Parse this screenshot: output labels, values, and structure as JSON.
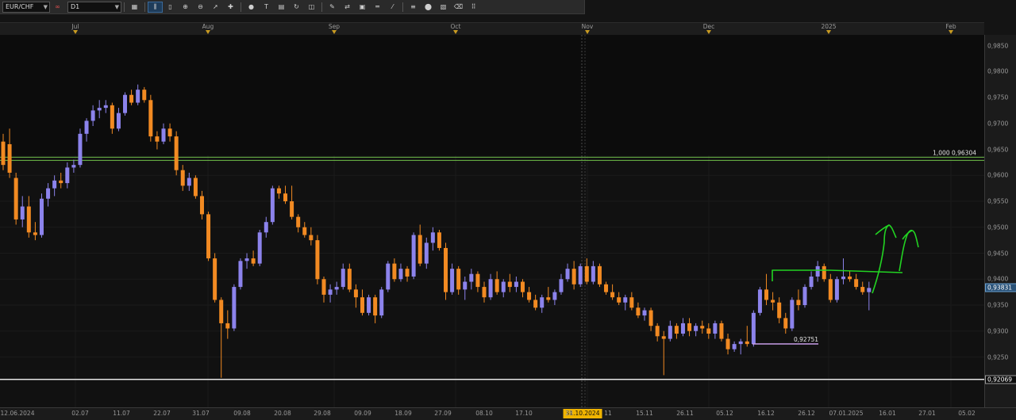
{
  "toolbar": {
    "symbol": "EUR/CHF",
    "timeframe": "D1",
    "link_glyph": "∞",
    "buttons": [
      {
        "name": "chart-type-icon",
        "glyph": "▦"
      },
      {
        "name": "bar-chart-icon",
        "glyph": "⫼",
        "active": true
      },
      {
        "name": "candle-chart-icon",
        "glyph": "▯"
      },
      {
        "name": "zoom-in-icon",
        "glyph": "⊕"
      },
      {
        "name": "zoom-out-icon",
        "glyph": "⊖"
      },
      {
        "name": "cursor-icon",
        "glyph": "➚"
      },
      {
        "name": "crosshair-icon",
        "glyph": "✚"
      },
      {
        "name": "marker-icon",
        "glyph": "●"
      },
      {
        "name": "text-icon",
        "glyph": "T"
      },
      {
        "name": "save-icon",
        "glyph": "▤"
      },
      {
        "name": "refresh-icon",
        "glyph": "↻"
      },
      {
        "name": "layers-icon",
        "glyph": "◫"
      },
      {
        "name": "pencil-icon",
        "glyph": "✎"
      },
      {
        "name": "indicator-icon",
        "glyph": "⇄"
      },
      {
        "name": "template-icon",
        "glyph": "▣"
      },
      {
        "name": "line-icon",
        "glyph": "═"
      },
      {
        "name": "trend-icon",
        "glyph": "⁄"
      },
      {
        "name": "fib-icon",
        "glyph": "≡"
      },
      {
        "name": "shape-icon",
        "glyph": "⬤"
      },
      {
        "name": "alert-icon",
        "glyph": "▧"
      },
      {
        "name": "eraser-icon",
        "glyph": "⌫"
      },
      {
        "name": "more-icon",
        "glyph": "⠿"
      }
    ]
  },
  "colors": {
    "bull": "#8c83ec",
    "bear": "#f28a22",
    "resistance": "#6fbf4a",
    "support": "#e6e6e6",
    "handdrawn": "#22d322",
    "fib_line": "#c79ee8"
  },
  "chart_data": {
    "type": "candlestick",
    "symbol": "EUR/CHF",
    "timeframe": "D1",
    "ylim": [
      0.918,
      0.988
    ],
    "y_ticks": [
      "0,9850",
      "0,9800",
      "0,9750",
      "0,9700",
      "0,9650",
      "0,9600",
      "0,9550",
      "0,9500",
      "0,9450",
      "0,9400",
      "0,9350",
      "0,9300",
      "0,9250"
    ],
    "x_ticks": [
      "12.06.2024",
      "02.07",
      "11.07",
      "22.07",
      "31.07",
      "09.08",
      "20.08",
      "29.08",
      "09.09",
      "18.09",
      "27.09",
      "08.10",
      "17.10",
      "28",
      "31.10.2024",
      "11",
      "15.11",
      "26.11",
      "05.12",
      "16.12",
      "26.12",
      "07.01.2025",
      "16.01",
      "27.01",
      "05.02"
    ],
    "month_labels": [
      "Jul",
      "Aug",
      "Sep",
      "Oct",
      "Nov",
      "Dec",
      "2025",
      "Feb"
    ],
    "cursor_date": "31.10.2024",
    "last_price_label": "0,93831",
    "support_level": {
      "value": 0.92069,
      "label": "0,92069"
    },
    "resistance_level": {
      "value": 0.96304,
      "label": "1,000 0,96304"
    },
    "swing_low_label": {
      "value": 0.92751,
      "label": "0,92751"
    },
    "candles": [
      [
        0.9665,
        0.968,
        0.961,
        0.962
      ],
      [
        0.966,
        0.969,
        0.9595,
        0.9605
      ],
      [
        0.9595,
        0.9605,
        0.9505,
        0.9515
      ],
      [
        0.9515,
        0.956,
        0.95,
        0.954
      ],
      [
        0.954,
        0.956,
        0.948,
        0.949
      ],
      [
        0.949,
        0.951,
        0.9475,
        0.9485
      ],
      [
        0.9485,
        0.9565,
        0.948,
        0.9555
      ],
      [
        0.9555,
        0.9585,
        0.954,
        0.9575
      ],
      [
        0.9575,
        0.96,
        0.956,
        0.959
      ],
      [
        0.959,
        0.9605,
        0.9575,
        0.9585
      ],
      [
        0.9585,
        0.9625,
        0.9575,
        0.9615
      ],
      [
        0.9615,
        0.963,
        0.9605,
        0.962
      ],
      [
        0.962,
        0.969,
        0.9615,
        0.968
      ],
      [
        0.968,
        0.971,
        0.9665,
        0.9705
      ],
      [
        0.9705,
        0.9735,
        0.9695,
        0.9725
      ],
      [
        0.9725,
        0.9745,
        0.971,
        0.973
      ],
      [
        0.973,
        0.9745,
        0.972,
        0.9735
      ],
      [
        0.9735,
        0.974,
        0.968,
        0.969
      ],
      [
        0.969,
        0.973,
        0.9685,
        0.972
      ],
      [
        0.972,
        0.976,
        0.9715,
        0.9755
      ],
      [
        0.9755,
        0.9765,
        0.9735,
        0.974
      ],
      [
        0.974,
        0.9775,
        0.9735,
        0.9765
      ],
      [
        0.9765,
        0.977,
        0.974,
        0.9745
      ],
      [
        0.9745,
        0.9755,
        0.9665,
        0.9675
      ],
      [
        0.9675,
        0.9685,
        0.965,
        0.9665
      ],
      [
        0.9665,
        0.97,
        0.966,
        0.969
      ],
      [
        0.969,
        0.97,
        0.9665,
        0.9675
      ],
      [
        0.9675,
        0.9685,
        0.96,
        0.961
      ],
      [
        0.961,
        0.962,
        0.957,
        0.958
      ],
      [
        0.958,
        0.9605,
        0.957,
        0.9595
      ],
      [
        0.9595,
        0.96,
        0.9555,
        0.956
      ],
      [
        0.956,
        0.957,
        0.9515,
        0.9525
      ],
      [
        0.9525,
        0.953,
        0.9435,
        0.944
      ],
      [
        0.944,
        0.945,
        0.9355,
        0.936
      ],
      [
        0.936,
        0.9365,
        0.921,
        0.9315
      ],
      [
        0.9315,
        0.934,
        0.9285,
        0.9305
      ],
      [
        0.9305,
        0.939,
        0.93,
        0.9385
      ],
      [
        0.9385,
        0.944,
        0.938,
        0.9435
      ],
      [
        0.9435,
        0.945,
        0.942,
        0.944
      ],
      [
        0.944,
        0.9455,
        0.9425,
        0.943
      ],
      [
        0.943,
        0.9495,
        0.9425,
        0.949
      ],
      [
        0.949,
        0.952,
        0.948,
        0.951
      ],
      [
        0.951,
        0.958,
        0.9505,
        0.9575
      ],
      [
        0.9575,
        0.958,
        0.9555,
        0.9565
      ],
      [
        0.9565,
        0.958,
        0.9545,
        0.955
      ],
      [
        0.955,
        0.958,
        0.9515,
        0.952
      ],
      [
        0.952,
        0.9525,
        0.949,
        0.95
      ],
      [
        0.95,
        0.951,
        0.948,
        0.9485
      ],
      [
        0.9485,
        0.95,
        0.9465,
        0.9475
      ],
      [
        0.9475,
        0.9485,
        0.939,
        0.94
      ],
      [
        0.94,
        0.9405,
        0.9355,
        0.937
      ],
      [
        0.937,
        0.939,
        0.9355,
        0.938
      ],
      [
        0.938,
        0.9395,
        0.937,
        0.9385
      ],
      [
        0.9385,
        0.943,
        0.938,
        0.942
      ],
      [
        0.942,
        0.943,
        0.9375,
        0.938
      ],
      [
        0.938,
        0.939,
        0.9345,
        0.9365
      ],
      [
        0.9365,
        0.938,
        0.933,
        0.9335
      ],
      [
        0.9335,
        0.937,
        0.933,
        0.9365
      ],
      [
        0.9365,
        0.937,
        0.9315,
        0.933
      ],
      [
        0.933,
        0.9385,
        0.9325,
        0.938
      ],
      [
        0.938,
        0.9435,
        0.9375,
        0.943
      ],
      [
        0.943,
        0.944,
        0.9395,
        0.94
      ],
      [
        0.94,
        0.943,
        0.9395,
        0.942
      ],
      [
        0.942,
        0.9425,
        0.9395,
        0.9405
      ],
      [
        0.9405,
        0.949,
        0.94,
        0.9485
      ],
      [
        0.9485,
        0.9505,
        0.9425,
        0.943
      ],
      [
        0.943,
        0.948,
        0.942,
        0.947
      ],
      [
        0.947,
        0.95,
        0.9455,
        0.949
      ],
      [
        0.949,
        0.9495,
        0.9455,
        0.946
      ],
      [
        0.946,
        0.947,
        0.936,
        0.9375
      ],
      [
        0.9375,
        0.943,
        0.937,
        0.942
      ],
      [
        0.942,
        0.9425,
        0.937,
        0.938
      ],
      [
        0.938,
        0.9405,
        0.936,
        0.9395
      ],
      [
        0.9395,
        0.942,
        0.938,
        0.941
      ],
      [
        0.941,
        0.9415,
        0.9375,
        0.9385
      ],
      [
        0.9385,
        0.9395,
        0.9355,
        0.9365
      ],
      [
        0.9365,
        0.941,
        0.936,
        0.94
      ],
      [
        0.94,
        0.9415,
        0.937,
        0.9375
      ],
      [
        0.9375,
        0.94,
        0.9365,
        0.9395
      ],
      [
        0.9395,
        0.941,
        0.9375,
        0.9385
      ],
      [
        0.9385,
        0.9405,
        0.9375,
        0.9395
      ],
      [
        0.9395,
        0.94,
        0.9365,
        0.9375
      ],
      [
        0.9375,
        0.9385,
        0.9355,
        0.936
      ],
      [
        0.936,
        0.937,
        0.934,
        0.9345
      ],
      [
        0.9345,
        0.937,
        0.9335,
        0.9365
      ],
      [
        0.9365,
        0.9385,
        0.9355,
        0.936
      ],
      [
        0.936,
        0.938,
        0.935,
        0.9375
      ],
      [
        0.9375,
        0.941,
        0.937,
        0.94
      ],
      [
        0.94,
        0.943,
        0.9395,
        0.942
      ],
      [
        0.942,
        0.9435,
        0.938,
        0.939
      ],
      [
        0.939,
        0.943,
        0.9385,
        0.9425
      ],
      [
        0.9425,
        0.944,
        0.939,
        0.9395
      ],
      [
        0.9395,
        0.9435,
        0.939,
        0.9425
      ],
      [
        0.9425,
        0.943,
        0.9385,
        0.939
      ],
      [
        0.939,
        0.9395,
        0.937,
        0.9375
      ],
      [
        0.9375,
        0.939,
        0.936,
        0.9365
      ],
      [
        0.9365,
        0.9375,
        0.935,
        0.9355
      ],
      [
        0.9355,
        0.937,
        0.934,
        0.9365
      ],
      [
        0.9365,
        0.9375,
        0.934,
        0.9345
      ],
      [
        0.9345,
        0.9355,
        0.9325,
        0.933
      ],
      [
        0.933,
        0.9345,
        0.932,
        0.934
      ],
      [
        0.934,
        0.9345,
        0.93,
        0.931
      ],
      [
        0.931,
        0.9315,
        0.928,
        0.929
      ],
      [
        0.929,
        0.93,
        0.9215,
        0.9285
      ],
      [
        0.9285,
        0.932,
        0.928,
        0.931
      ],
      [
        0.931,
        0.9315,
        0.9285,
        0.9295
      ],
      [
        0.9295,
        0.9325,
        0.929,
        0.9315
      ],
      [
        0.9315,
        0.9325,
        0.929,
        0.93
      ],
      [
        0.93,
        0.9315,
        0.929,
        0.931
      ],
      [
        0.931,
        0.932,
        0.9295,
        0.9305
      ],
      [
        0.9305,
        0.9315,
        0.9285,
        0.9295
      ],
      [
        0.9295,
        0.932,
        0.9285,
        0.9315
      ],
      [
        0.9315,
        0.932,
        0.928,
        0.9285
      ],
      [
        0.9285,
        0.9295,
        0.9255,
        0.9265
      ],
      [
        0.9265,
        0.928,
        0.926,
        0.9275
      ],
      [
        0.9275,
        0.9285,
        0.9255,
        0.928
      ],
      [
        0.928,
        0.931,
        0.927,
        0.9275
      ],
      [
        0.9275,
        0.934,
        0.927,
        0.9335
      ],
      [
        0.9335,
        0.9385,
        0.933,
        0.938
      ],
      [
        0.938,
        0.941,
        0.935,
        0.936
      ],
      [
        0.936,
        0.9375,
        0.934,
        0.9355
      ],
      [
        0.9355,
        0.9365,
        0.9315,
        0.9325
      ],
      [
        0.9325,
        0.9335,
        0.9295,
        0.9305
      ],
      [
        0.9305,
        0.9365,
        0.93,
        0.936
      ],
      [
        0.936,
        0.938,
        0.934,
        0.935
      ],
      [
        0.935,
        0.939,
        0.9345,
        0.9385
      ],
      [
        0.9385,
        0.9415,
        0.938,
        0.9405
      ],
      [
        0.9405,
        0.9435,
        0.9395,
        0.9425
      ],
      [
        0.9425,
        0.943,
        0.9395,
        0.94
      ],
      [
        0.94,
        0.941,
        0.9355,
        0.936
      ],
      [
        0.936,
        0.9405,
        0.9355,
        0.94
      ],
      [
        0.94,
        0.944,
        0.939,
        0.9405
      ],
      [
        0.9405,
        0.9415,
        0.9395,
        0.94
      ],
      [
        0.94,
        0.941,
        0.938,
        0.9385
      ],
      [
        0.9385,
        0.9395,
        0.937,
        0.9375
      ],
      [
        0.9375,
        0.9395,
        0.934,
        0.9383
      ]
    ]
  }
}
